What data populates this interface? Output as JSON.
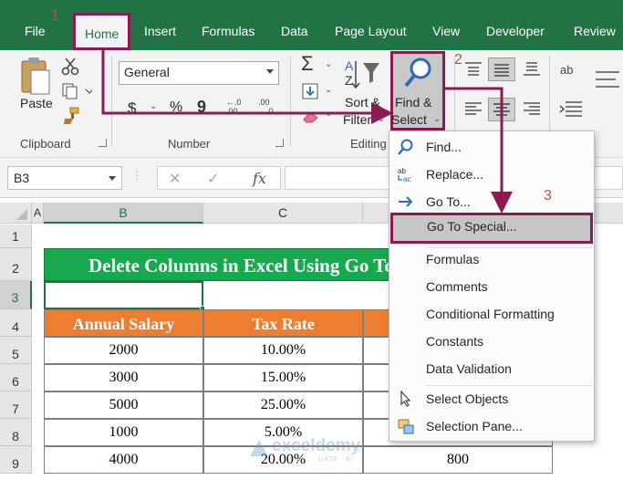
{
  "ribbon": {
    "tabs": [
      {
        "label": "File"
      },
      {
        "label": "Home"
      },
      {
        "label": "Insert"
      },
      {
        "label": "Formulas"
      },
      {
        "label": "Data"
      },
      {
        "label": "Page Layout"
      },
      {
        "label": "View"
      },
      {
        "label": "Developer"
      },
      {
        "label": "Review"
      }
    ],
    "clipboard": {
      "paste_label": "Paste",
      "group_label": "Clipboard"
    },
    "number": {
      "format_value": "General",
      "group_label": "Number",
      "currency_symbol": "$",
      "percent_symbol": "%",
      "comma_symbol": "9",
      "inc_decimal": "←.0 .00",
      "dec_decimal": ".00 →.0"
    },
    "editing": {
      "sum_symbol": "Σ",
      "sort_filter_line1": "Sort &",
      "sort_filter_line2": "Filter",
      "find_select_line1": "Find &",
      "find_select_line2": "Select",
      "group_label": "Editing"
    }
  },
  "formula_bar": {
    "name_box": "B3",
    "cancel_symbol": "✕",
    "enter_symbol": "✓",
    "fx_label": "fx",
    "formula_value": ""
  },
  "grid": {
    "columns": [
      "A",
      "B",
      "C"
    ],
    "rows": [
      "1",
      "2",
      "3",
      "4",
      "5",
      "6",
      "7",
      "8",
      "9"
    ],
    "title": "Delete Columns in Excel Using Go To Special",
    "headers": [
      "Annual Salary",
      "Tax Rate"
    ],
    "rows_data": [
      {
        "salary": "2000",
        "rate": "10.00%",
        "tax": ""
      },
      {
        "salary": "3000",
        "rate": "15.00%",
        "tax": ""
      },
      {
        "salary": "5000",
        "rate": "25.00%",
        "tax": ""
      },
      {
        "salary": "1000",
        "rate": "5.00%",
        "tax": ""
      },
      {
        "salary": "4000",
        "rate": "20.00%",
        "tax": "800"
      }
    ]
  },
  "menu": {
    "items": [
      {
        "label": "Find...",
        "icon": "search-icon"
      },
      {
        "label": "Replace...",
        "icon": "replace-icon"
      },
      {
        "label": "Go To...",
        "icon": "arrow-right-icon"
      },
      {
        "label": "Go To Special...",
        "icon": ""
      },
      {
        "label": "Formulas",
        "icon": ""
      },
      {
        "label": "Comments",
        "icon": ""
      },
      {
        "label": "Conditional Formatting",
        "icon": ""
      },
      {
        "label": "Constants",
        "icon": ""
      },
      {
        "label": "Data Validation",
        "icon": ""
      },
      {
        "label": "Select Objects",
        "icon": "cursor-icon"
      },
      {
        "label": "Selection Pane...",
        "icon": "selection-pane-icon"
      }
    ]
  },
  "annotations": {
    "step1": "1",
    "step2": "2",
    "step3": "3",
    "highlight_color": "#8b1b52"
  },
  "watermark": {
    "brand": "exceldemy",
    "tagline": "EXCEL · DATA · BI"
  },
  "colors": {
    "excel_green": "#217346",
    "title_fill": "#18a94f",
    "header_fill": "#ed7d31"
  }
}
